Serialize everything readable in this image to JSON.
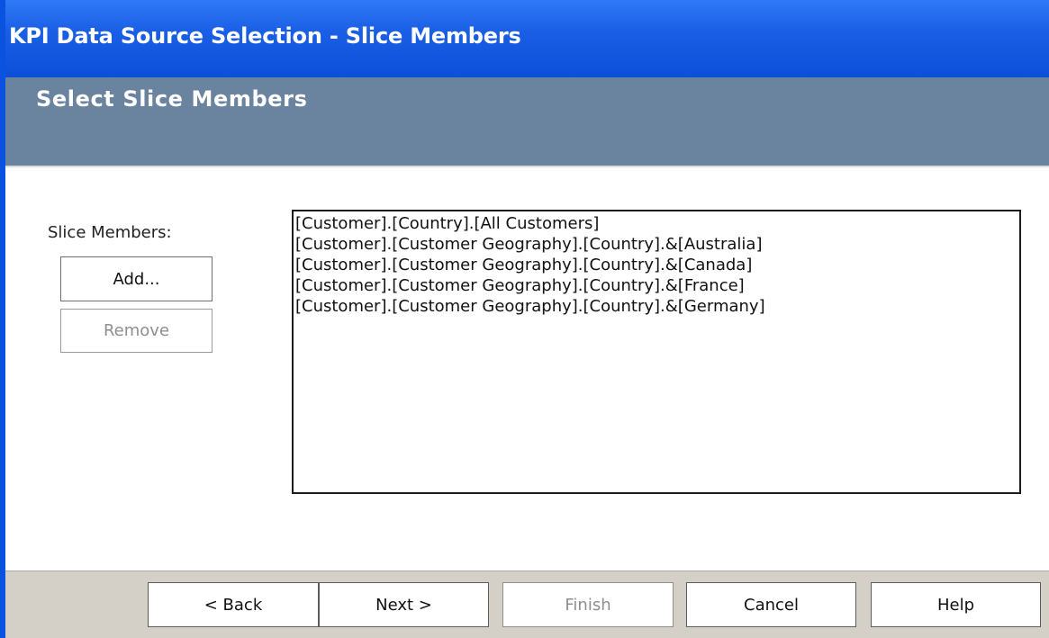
{
  "window": {
    "title": "KPI Data Source Selection - Slice Members"
  },
  "header": {
    "heading": "Select Slice Members"
  },
  "slice_panel": {
    "label": "Slice Members:",
    "add_label": "Add...",
    "remove_label": "Remove",
    "members": [
      "[Customer].[Country].[All Customers]",
      "[Customer].[Customer Geography].[Country].&[Australia]",
      "[Customer].[Customer Geography].[Country].&[Canada]",
      "[Customer].[Customer Geography].[Country].&[France]",
      "[Customer].[Customer Geography].[Country].&[Germany]"
    ]
  },
  "footer": {
    "back_label": "< Back",
    "next_label": "Next >",
    "finish_label": "Finish",
    "cancel_label": "Cancel",
    "help_label": "Help"
  },
  "colors": {
    "title_bar": "#0c4fd8",
    "header_band": "#6a84a0",
    "footer": "#d4d0c8"
  }
}
